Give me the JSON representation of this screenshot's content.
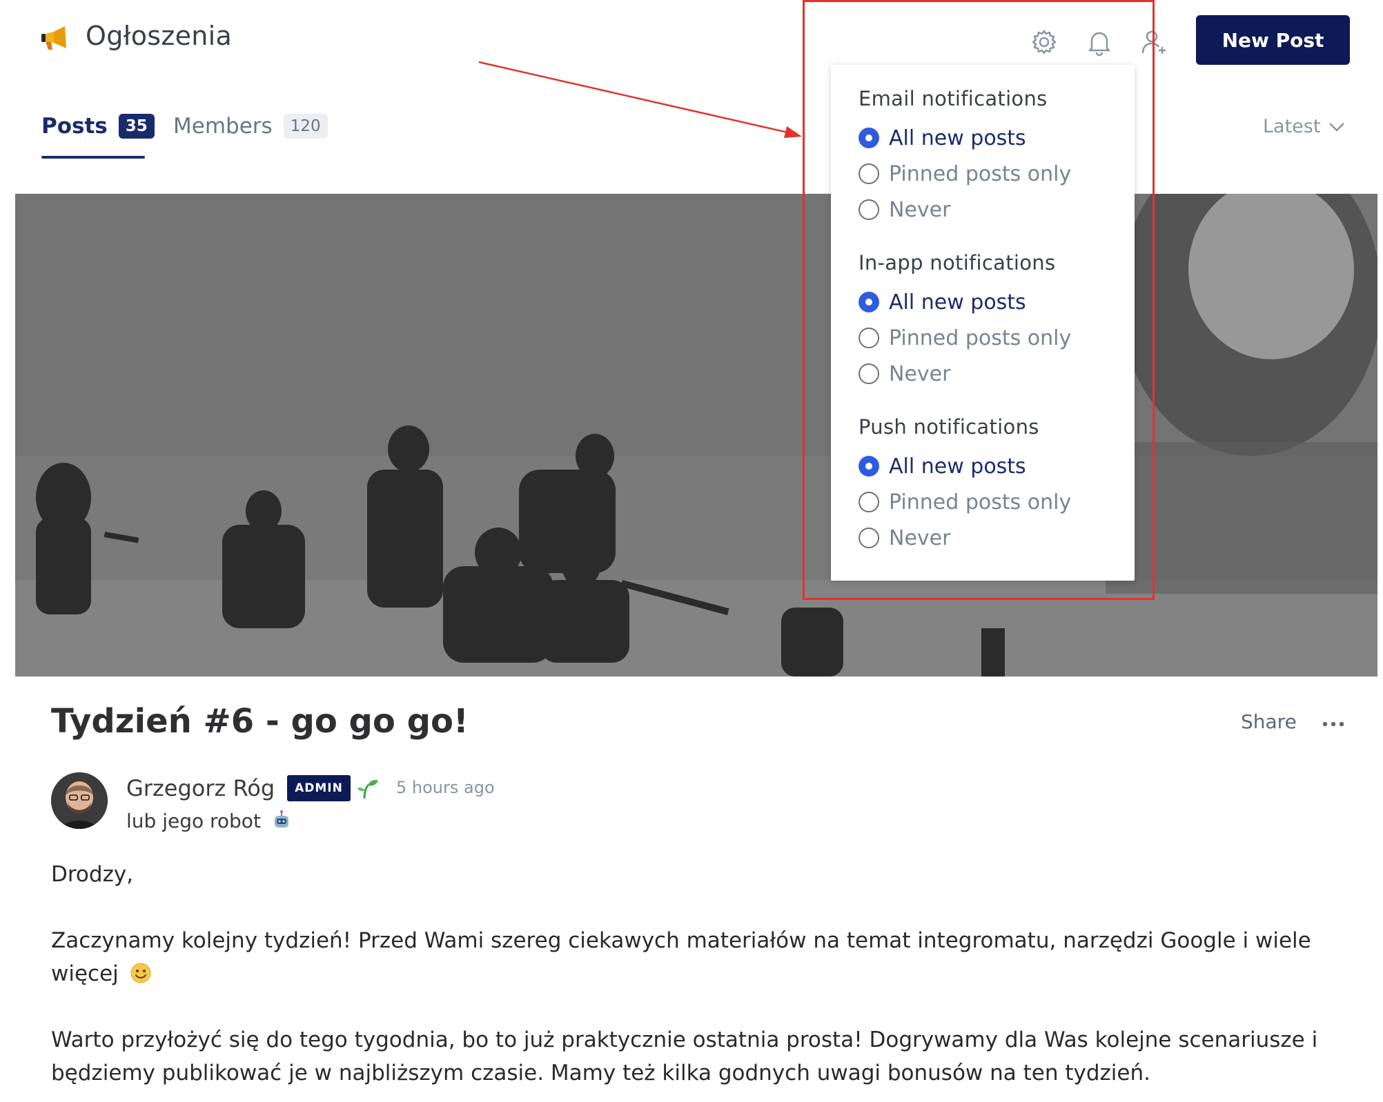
{
  "header": {
    "space_title": "Ogłoszenia",
    "new_post_label": "New Post",
    "icons": [
      "megaphone-icon",
      "gear-icon",
      "bell-icon",
      "add-user-icon"
    ]
  },
  "tabs": [
    {
      "label": "Posts",
      "count": "35",
      "active": true
    },
    {
      "label": "Members",
      "count": "120",
      "active": false
    }
  ],
  "sort": {
    "label": "Latest"
  },
  "notifications": {
    "sections": [
      {
        "heading": "Email notifications",
        "options": [
          "All new posts",
          "Pinned posts only",
          "Never"
        ],
        "selected": "All new posts"
      },
      {
        "heading": "In-app notifications",
        "options": [
          "All new posts",
          "Pinned posts only",
          "Never"
        ],
        "selected": "All new posts"
      },
      {
        "heading": "Push notifications",
        "options": [
          "All new posts",
          "Pinned posts only",
          "Never"
        ],
        "selected": "All new posts"
      }
    ]
  },
  "post": {
    "title": "Tydzień #6 - go go go!",
    "share_label": "Share",
    "author": {
      "name": "Grzegorz Róg",
      "badge": "ADMIN",
      "headline": "lub jego robot"
    },
    "time": "5 hours ago",
    "body": [
      "Drodzy,",
      "Zaczynamy kolejny tydzień! Przed Wami szereg ciekawych materiałów na temat integromatu, narzędzi Google i wiele więcej",
      "Warto przyłożyć się do tego tygodnia, bo to już praktycznie ostatnia prosta! Dogrywamy dla Was kolejne scenariusze i będziemy publikować je w najbliższym czasie. Mamy też kilka godnych uwagi bonusów na ten tydzień."
    ]
  },
  "colors": {
    "brand": "#0e1a55",
    "radio_checked": "#2f5be0",
    "annotation": "#e2332c"
  }
}
